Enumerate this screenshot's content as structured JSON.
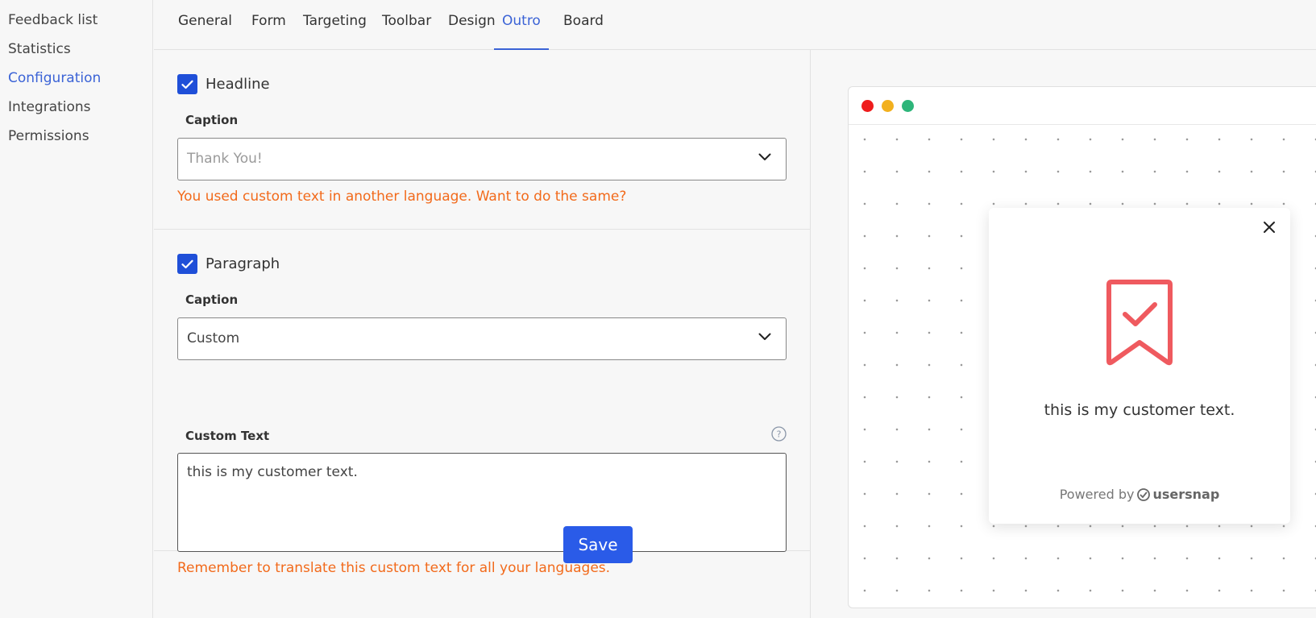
{
  "sidebar": {
    "items": [
      {
        "label": "Feedback list"
      },
      {
        "label": "Statistics"
      },
      {
        "label": "Configuration",
        "active": true
      },
      {
        "label": "Integrations"
      },
      {
        "label": "Permissions"
      }
    ]
  },
  "tabs": [
    {
      "label": "General"
    },
    {
      "label": "Form"
    },
    {
      "label": "Targeting"
    },
    {
      "label": "Toolbar"
    },
    {
      "label": "Design"
    },
    {
      "label": "Outro",
      "active": true
    },
    {
      "label": "Board"
    }
  ],
  "headline": {
    "checkbox_label": "Headline",
    "checked": true,
    "caption_label": "Caption",
    "caption_value": "Thank You!",
    "warning": "You used custom text in another language. Want to do the same?"
  },
  "paragraph": {
    "checkbox_label": "Paragraph",
    "checked": true,
    "caption_label": "Caption",
    "caption_value": "Custom",
    "custom_text_label": "Custom Text",
    "custom_text_value": "this is my customer text.",
    "warning": "Remember to translate this custom text for all your languages."
  },
  "actions": {
    "save_label": "Save"
  },
  "preview": {
    "widget_text": "this is my customer text.",
    "powered_by": "Powered by",
    "brand_name": "usersnap"
  },
  "colors": {
    "accent": "#2a5be8",
    "tab_active": "#3b63d6",
    "warning": "#f26a1b",
    "dot_red": "#ee1c1c",
    "dot_yellow": "#f2b01e",
    "dot_green": "#2db57a",
    "bookmark": "#ef5a5f"
  }
}
